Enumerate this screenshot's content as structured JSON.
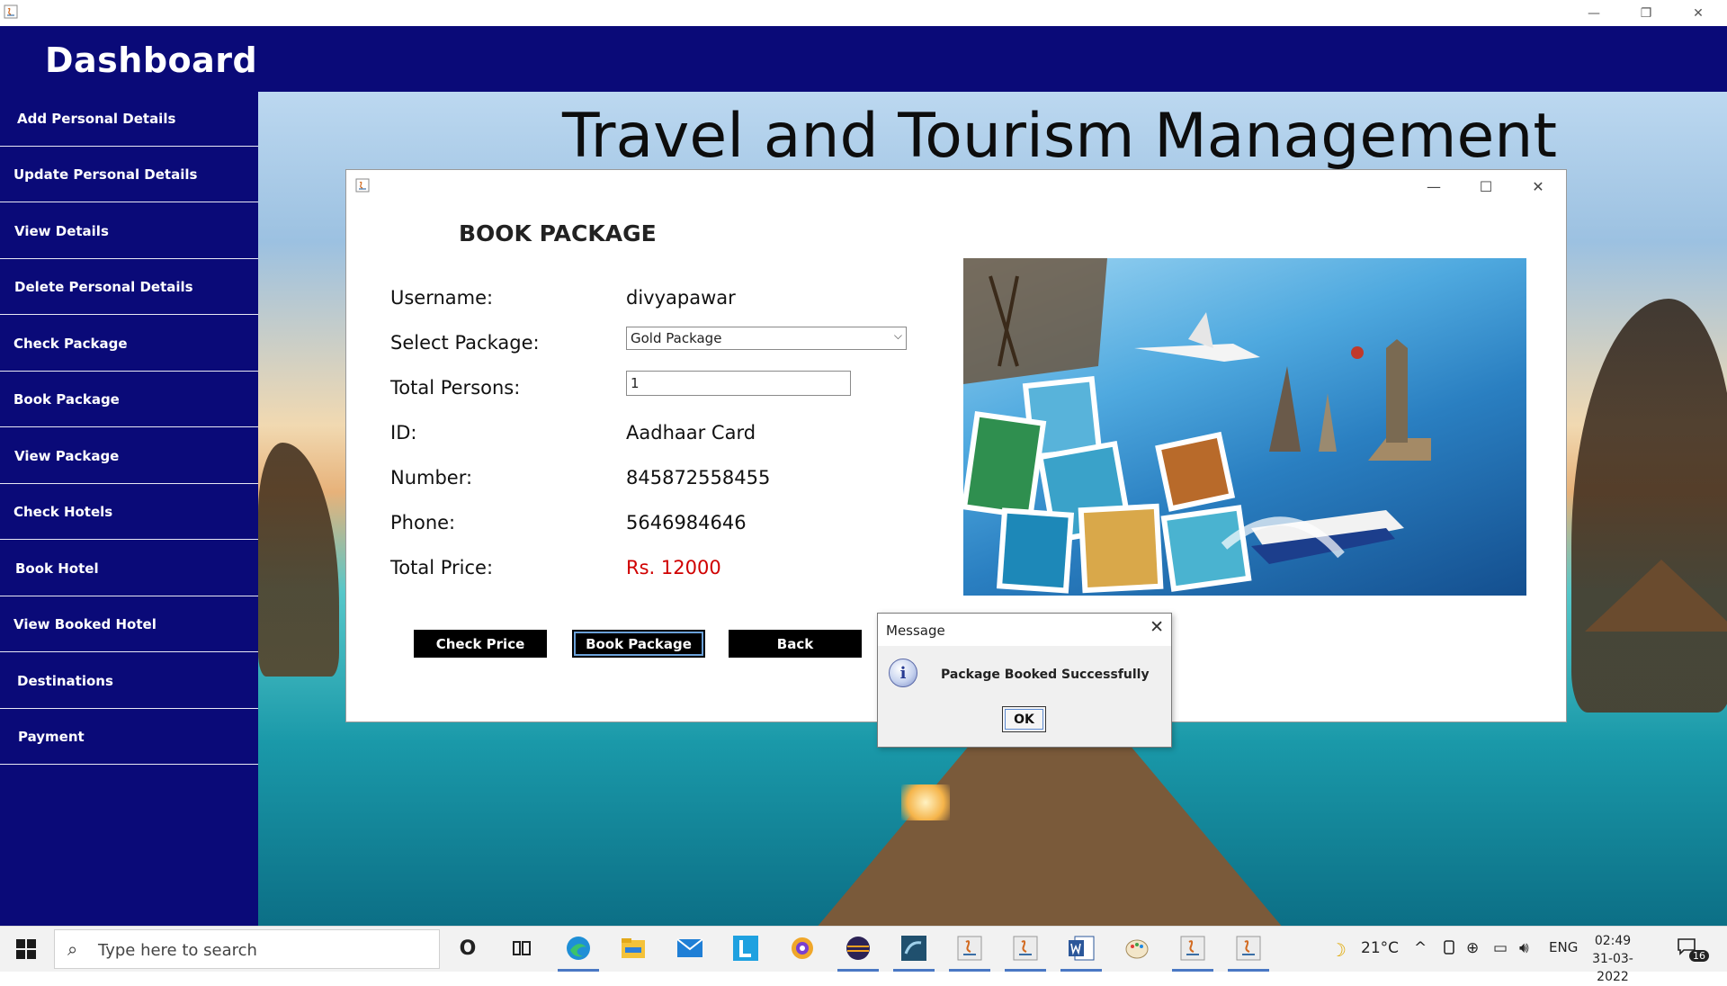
{
  "window": {
    "minimize_glyph": "—",
    "restore_glyph": "❐",
    "close_glyph": "✕"
  },
  "dashboard": {
    "title": "Dashboard"
  },
  "sidebar": {
    "items": [
      {
        "label": "Add Personal Details"
      },
      {
        "label": "Update Personal Details"
      },
      {
        "label": "View Details"
      },
      {
        "label": "Delete Personal Details"
      },
      {
        "label": "Check Package"
      },
      {
        "label": "Book Package"
      },
      {
        "label": "View Package"
      },
      {
        "label": "Check Hotels"
      },
      {
        "label": "Book Hotel"
      },
      {
        "label": "View Booked Hotel"
      },
      {
        "label": "Destinations"
      },
      {
        "label": "Payment"
      }
    ]
  },
  "main": {
    "title": "Travel and Tourism Management"
  },
  "book_window": {
    "controls": {
      "minimize_glyph": "—",
      "maximize_glyph": "☐",
      "close_glyph": "✕"
    },
    "heading": "BOOK PACKAGE",
    "fields": {
      "username_label": "Username:",
      "username_value": "divyapawar",
      "package_label": "Select Package:",
      "package_selected": "Gold Package",
      "persons_label": "Total Persons:",
      "persons_value": "1",
      "id_label": "ID:",
      "id_value": "Aadhaar Card",
      "number_label": "Number:",
      "number_value": "845872558455",
      "phone_label": "Phone:",
      "phone_value": "5646984646",
      "price_label": "Total Price:",
      "price_value": "Rs. 12000"
    },
    "buttons": {
      "check_price": "Check Price",
      "book_package": "Book Package",
      "back": "Back"
    }
  },
  "message_dialog": {
    "title": "Message",
    "close_glyph": "✕",
    "icon_glyph": "i",
    "text": "Package Booked Successfully",
    "ok_label": "OK"
  },
  "taskbar": {
    "search_placeholder": "Type here to search",
    "search_glyph": "⌕",
    "cortana_glyph": "O",
    "weather_glyph": "☽",
    "temperature": "21°C",
    "language": "ENG",
    "time": "02:49",
    "date": "31-03-2022",
    "notification_count": "16",
    "tray_glyphs": {
      "chevron": "^",
      "network": "⊕",
      "battery": "▭",
      "volume": "🔊︎"
    }
  },
  "colors": {
    "sidebar_bg": "#0a0a78",
    "price_red": "#d00000",
    "button_bg": "#000000"
  }
}
